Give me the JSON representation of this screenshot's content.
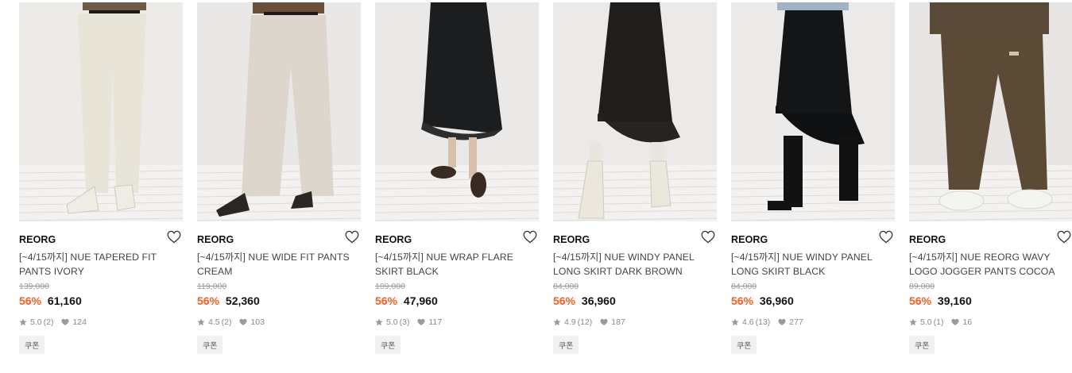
{
  "products": [
    {
      "brand": "REORG",
      "name": "[~4/15까지] NUE TAPERED FIT PANTS IVORY",
      "original_price": "139,000",
      "discount": "56%",
      "price": "61,160",
      "rating": "5.0",
      "reviews": "(2)",
      "likes": "124",
      "badge": "쿠폰",
      "image": "ivory tapered pants on model with white ankle boots",
      "image_colors": {
        "bg": "#ecebe8",
        "garment": "#e9e4d8",
        "shoe": "#efece4"
      }
    },
    {
      "brand": "REORG",
      "name": "[~4/15까지] NUE WIDE FIT PANTS CREAM",
      "original_price": "119,000",
      "discount": "56%",
      "price": "52,360",
      "rating": "4.5",
      "reviews": "(2)",
      "likes": "103",
      "badge": "쿠폰",
      "image": "cream wide pants on model with black loafers",
      "image_colors": {
        "bg": "#e9e8e6",
        "garment": "#dcd6cd",
        "shoe": "#2a2622"
      }
    },
    {
      "brand": "REORG",
      "name": "[~4/15까지] NUE WRAP FLARE SKIRT BLACK",
      "original_price": "109,000",
      "discount": "56%",
      "price": "47,960",
      "rating": "5.0",
      "reviews": "(3)",
      "likes": "117",
      "badge": "쿠폰",
      "image": "black wrap flare skirt with dark mules",
      "image_colors": {
        "bg": "#eae9e7",
        "garment": "#1c1d1f",
        "shoe": "#3a2a24"
      }
    },
    {
      "brand": "REORG",
      "name": "[~4/15까지] NUE WINDY PANEL LONG SKIRT DARK BROWN",
      "original_price": "84,000",
      "discount": "56%",
      "price": "36,960",
      "rating": "4.9",
      "reviews": "(12)",
      "likes": "187",
      "badge": "쿠폰",
      "image": "dark brown panel long skirt with white ankle boots",
      "image_colors": {
        "bg": "#ebeae8",
        "garment": "#201e1d",
        "shoe": "#ece7dc"
      }
    },
    {
      "brand": "REORG",
      "name": "[~4/15까지] NUE WINDY PANEL LONG SKIRT BLACK",
      "original_price": "84,000",
      "discount": "56%",
      "price": "36,960",
      "rating": "4.6",
      "reviews": "(13)",
      "likes": "277",
      "badge": "쿠폰",
      "image": "black panel long skirt with black knee boots",
      "image_colors": {
        "bg": "#eceae8",
        "garment": "#141516",
        "shoe": "#121212"
      }
    },
    {
      "brand": "REORG",
      "name": "[~4/15까지] NUE REORG WAVY LOGO JOGGER PANTS COCOA",
      "original_price": "89,000",
      "discount": "56%",
      "price": "39,160",
      "rating": "5.0",
      "reviews": "(1)",
      "likes": "16",
      "badge": "쿠폰",
      "image": "cocoa jogger pants with white sneakers",
      "image_colors": {
        "bg": "#e7e6e4",
        "garment": "#5b4a36",
        "shoe": "#f4f4f2"
      }
    }
  ]
}
